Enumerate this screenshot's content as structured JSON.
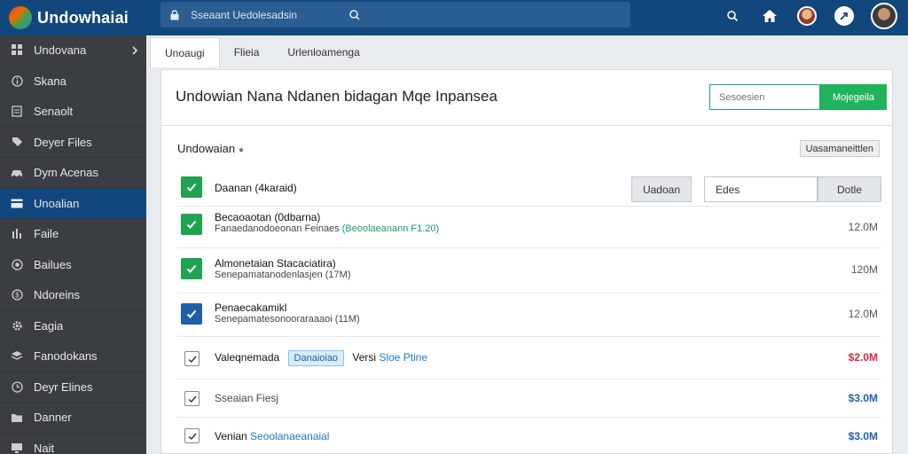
{
  "app": {
    "title": "Undowhaiai"
  },
  "colors": {
    "brand": "#11477c",
    "accent_green": "#20b35a",
    "active_blue": "#1f5fa8",
    "alert_red": "#d7263d"
  },
  "search": {
    "placeholder": "Sseaant Uedolesadsin",
    "icon": "lock-icon"
  },
  "topbar_icons": [
    "search-icon",
    "home-icon",
    "user-avatar",
    "share-icon",
    "profile-avatar"
  ],
  "sidebar": {
    "items": [
      {
        "label": "Undovana",
        "icon": "grid-icon",
        "chevron": true
      },
      {
        "label": "Skana",
        "icon": "info-icon"
      },
      {
        "label": "Senaolt",
        "icon": "square-icon"
      },
      {
        "label": "Deyer Files",
        "icon": "tag-icon"
      },
      {
        "label": "Dym Acenas",
        "icon": "car-icon"
      },
      {
        "label": "Unoalian",
        "icon": "card-icon",
        "active": true
      },
      {
        "label": "Faile",
        "icon": "bars-icon"
      },
      {
        "label": "Bailues",
        "icon": "circle-icon"
      },
      {
        "label": "Ndoreins",
        "icon": "coin-icon"
      },
      {
        "label": "Eagia",
        "icon": "gear-icon"
      },
      {
        "label": "Fanodokans",
        "icon": "stack-icon"
      },
      {
        "label": "Deyr Elines",
        "icon": "clock-icon"
      },
      {
        "label": "Danner",
        "icon": "folder-icon"
      },
      {
        "label": "Nait",
        "icon": "monitor-icon"
      }
    ]
  },
  "tabs": [
    {
      "label": "Unoaugi",
      "active": true
    },
    {
      "label": "Flieia"
    },
    {
      "label": "Urlenloamenga"
    }
  ],
  "header": {
    "title": "Undowian Nana Ndanen bidagan Mqe Inpansea",
    "input_placeholder": "Sesoesien",
    "button_label": "Mojegeila"
  },
  "section": {
    "title": "Undowaian",
    "marker": "●",
    "action_label": "Uasamaneittlen"
  },
  "rows": [
    {
      "title": "Daanan (4karaid)",
      "check": "green",
      "btn1": "Uadoan",
      "input_value": "Edes",
      "btn2": "Dotle"
    },
    {
      "title": "Becaoaotan (0dbarna)",
      "sub": "Fanaedanodoeonan Feinaes",
      "sub_accent": "(Beoolaeanann F1.20)",
      "amount": "12.0M",
      "check": "green"
    },
    {
      "title": "Almonetaian Stacaciatira)",
      "sub": "Senepamatanodenlasjen (17M)",
      "amount": "120M",
      "check": "green"
    },
    {
      "title": "Penaecakamikl",
      "sub": "Senepamatesonooraraaaoi (11M)",
      "amount": "12.0M",
      "check": "blue"
    },
    {
      "title": "Valeqnemada",
      "pill": "Danaioiao",
      "mid": "Versi",
      "link": "Sloe Ptine",
      "amount": "$2.0M",
      "amount_style": "red",
      "check": "outline"
    },
    {
      "title": "Sseaian Fiesj",
      "amount": "$3.0M",
      "amount_style": "blue",
      "check": "outline"
    },
    {
      "title": "Venian",
      "link": "Seoolanaeanaial",
      "amount": "$3.0M",
      "amount_style": "blue",
      "check": "outline"
    }
  ]
}
